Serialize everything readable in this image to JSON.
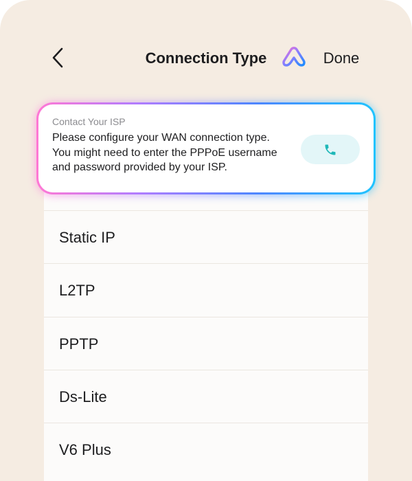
{
  "header": {
    "title": "Connection Type",
    "done_label": "Done"
  },
  "isp_card": {
    "heading": "Contact Your ISP",
    "message": "Please configure your WAN connection type. You might need to enter the PPPoE username and password provided by your ISP.",
    "call_icon": "phone-icon"
  },
  "connection_types": [
    {
      "label": "Static IP"
    },
    {
      "label": "L2TP"
    },
    {
      "label": "PPTP"
    },
    {
      "label": "Ds-Lite"
    },
    {
      "label": "V6 Plus"
    }
  ],
  "colors": {
    "background": "#f5ece2",
    "list_background": "#fcfbfa",
    "text": "#1d1d1f",
    "muted_text": "#8b8b8f",
    "call_button_bg": "#e3f6f8",
    "call_icon": "#1fb8b8",
    "gradient_pink": "#ff78d4",
    "gradient_purple": "#b07cff",
    "gradient_blue": "#4d86ff",
    "gradient_cyan": "#1fc4ff"
  }
}
